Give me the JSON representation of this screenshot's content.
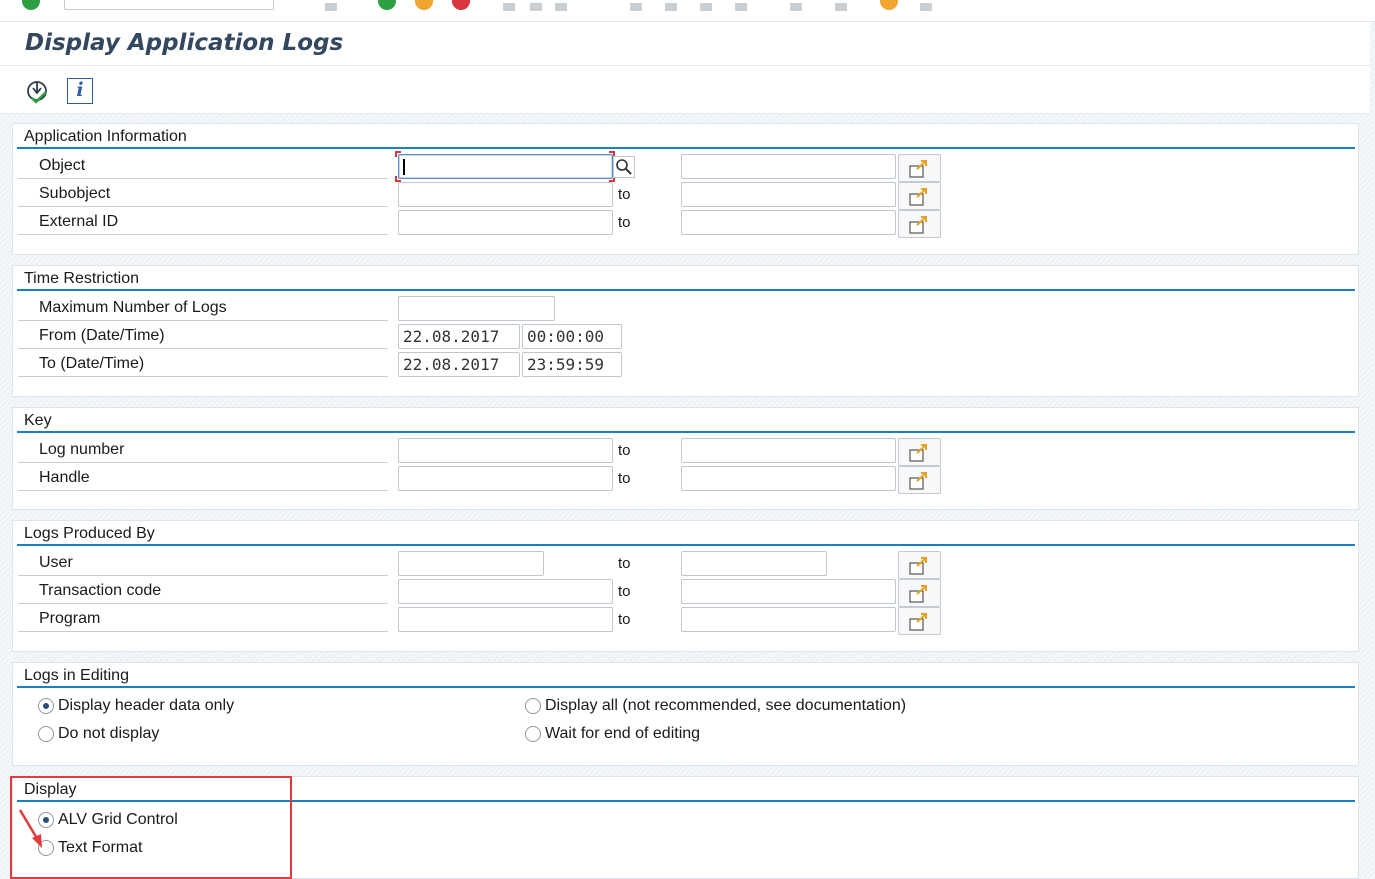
{
  "page": {
    "title": "Display Application Logs"
  },
  "toolbar": {
    "execute_icon": "execute-icon",
    "info_icon": "info-icon",
    "info_glyph": "i"
  },
  "groups": {
    "application_information": {
      "title": "Application Information",
      "rows": [
        {
          "label": "Object",
          "to": ""
        },
        {
          "label": "Subobject",
          "to": "to"
        },
        {
          "label": "External ID",
          "to": "to"
        }
      ]
    },
    "time_restriction": {
      "title": "Time Restriction",
      "max_logs_label": "Maximum Number of Logs",
      "max_logs_value": "",
      "from_label": "From (Date/Time)",
      "from_date": "22.08.2017",
      "from_time": "00:00:00",
      "to_label": "To (Date/Time)",
      "to_date": "22.08.2017",
      "to_time": "23:59:59"
    },
    "key": {
      "title": "Key",
      "rows": [
        {
          "label": "Log number",
          "to": "to"
        },
        {
          "label": "Handle",
          "to": "to"
        }
      ]
    },
    "logs_produced_by": {
      "title": "Logs Produced By",
      "rows": [
        {
          "label": "User",
          "to": "to"
        },
        {
          "label": "Transaction code",
          "to": "to"
        },
        {
          "label": "Program",
          "to": "to"
        }
      ]
    },
    "logs_in_editing": {
      "title": "Logs in Editing",
      "options": [
        {
          "label": "Display header data only",
          "selected": true
        },
        {
          "label": "Do not display",
          "selected": false
        },
        {
          "label": "Display all (not recommended, see documentation)",
          "selected": false
        },
        {
          "label": "Wait for end of editing",
          "selected": false
        }
      ]
    },
    "display": {
      "title": "Display",
      "options": [
        {
          "label": "ALV Grid Control",
          "selected": true
        },
        {
          "label": "Text Format",
          "selected": false
        }
      ]
    }
  },
  "colors": {
    "group_line": "#1a7fc4",
    "highlight": "#e23b3b",
    "title": "#33475f"
  }
}
